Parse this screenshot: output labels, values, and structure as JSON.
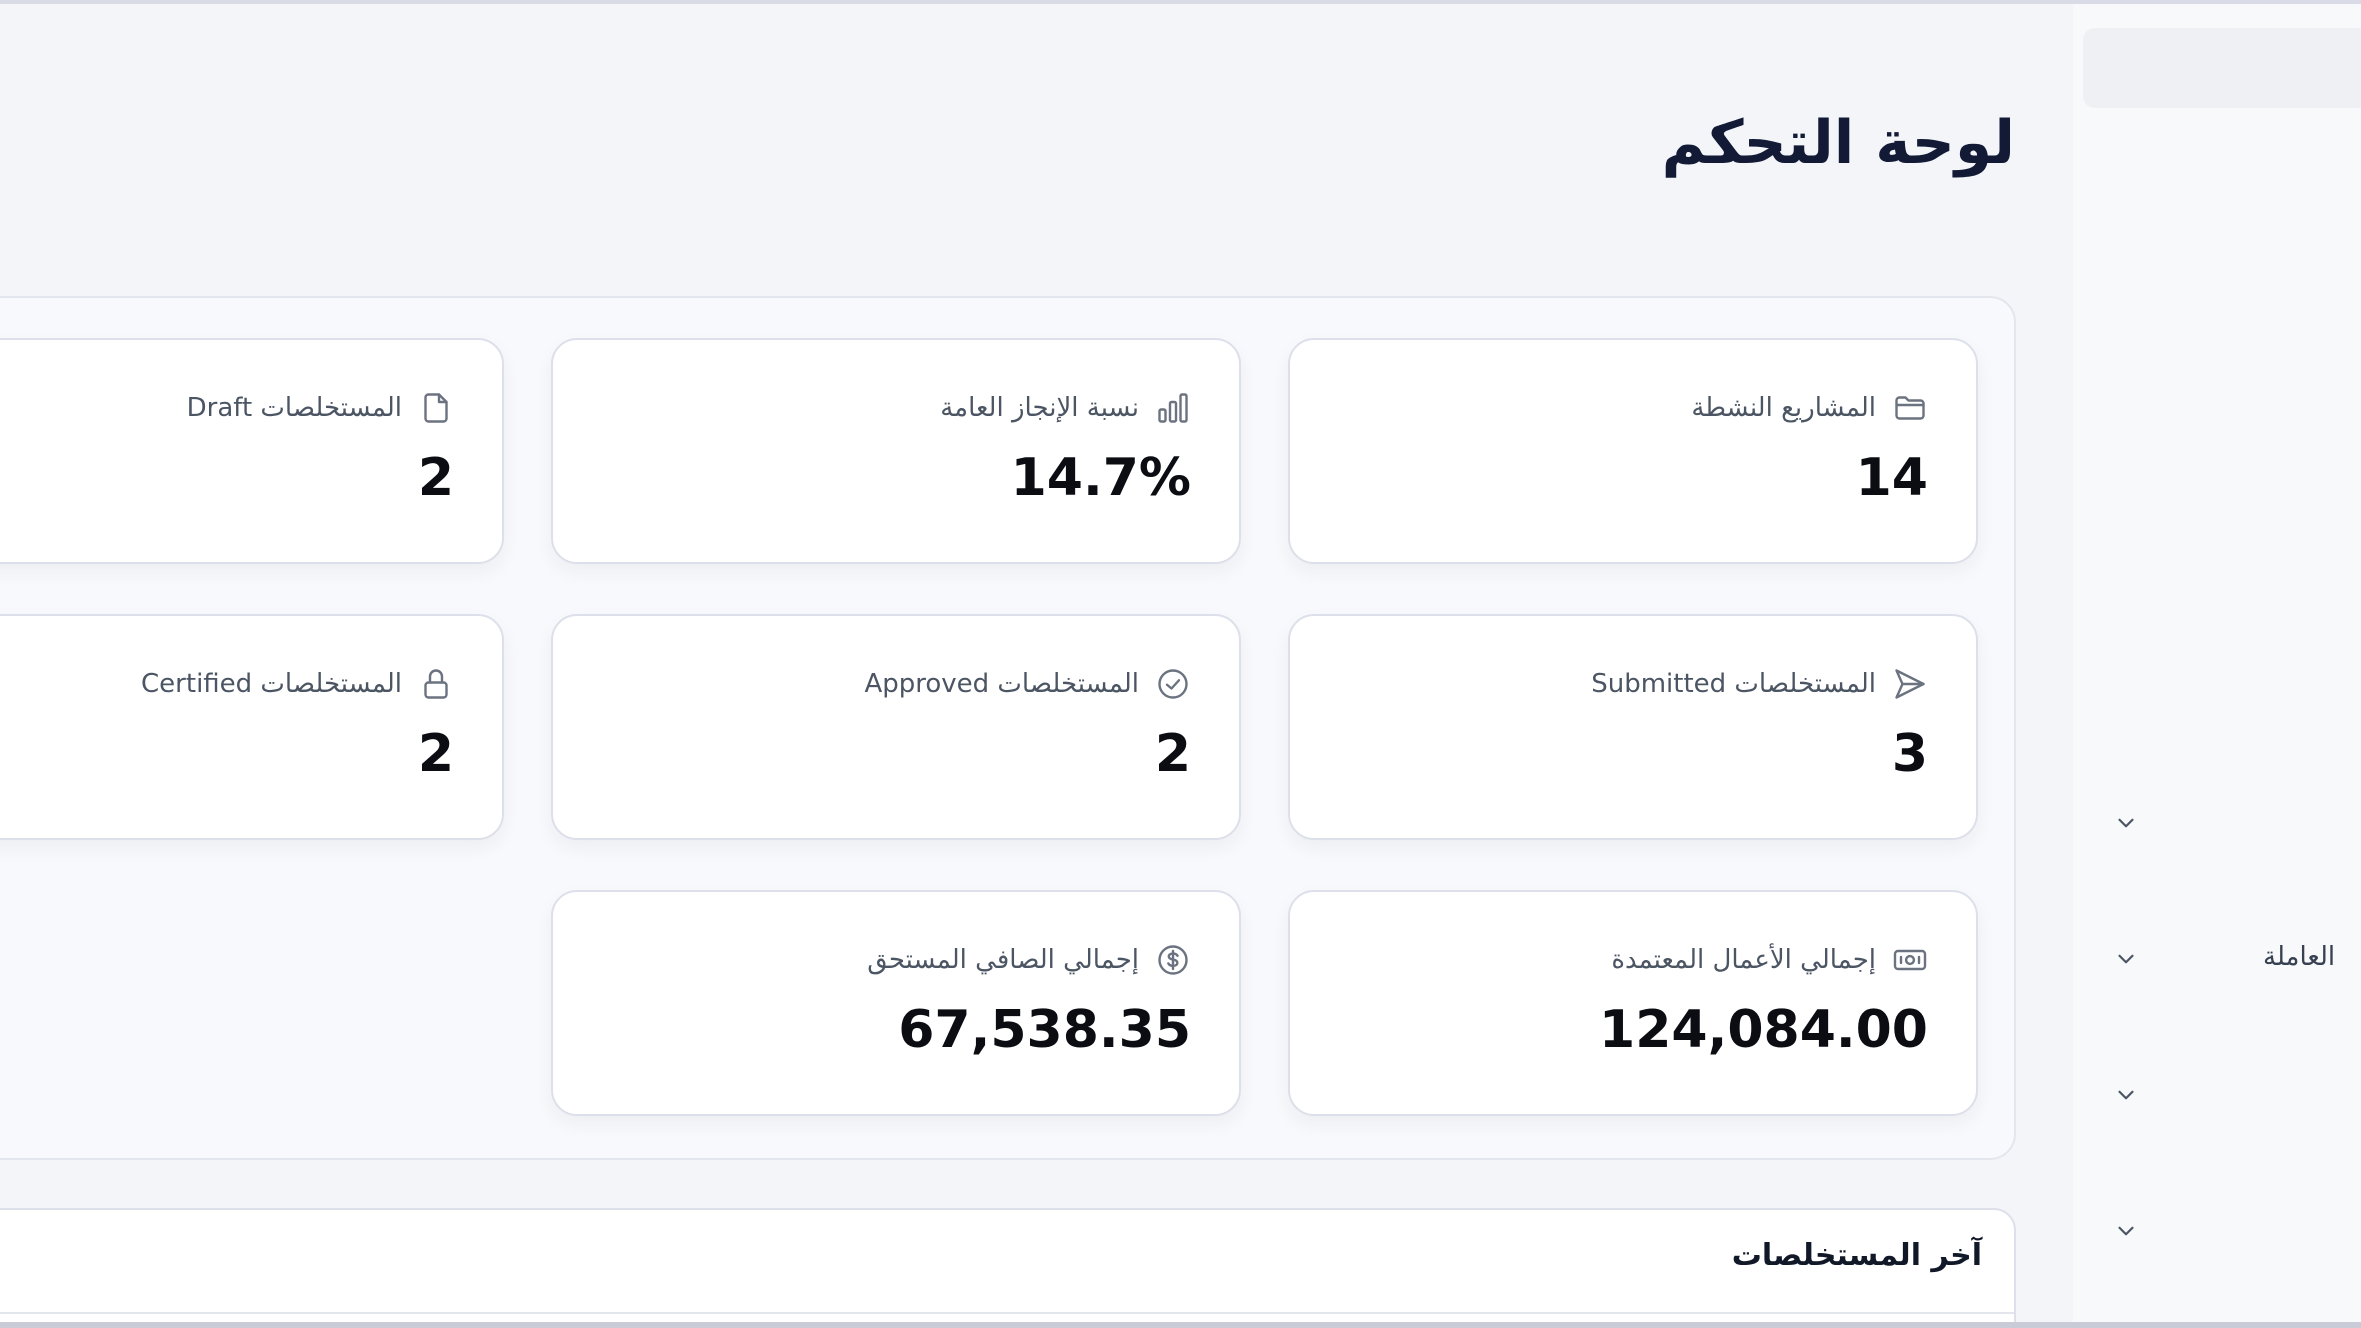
{
  "page": {
    "title": "لوحة التحكم"
  },
  "sidebar": {
    "items": [
      {
        "label": "",
        "icon": "chevron-down-icon"
      },
      {
        "label": "العاملة",
        "icon": "chevron-down-icon"
      },
      {
        "label": "",
        "icon": "chevron-down-icon"
      },
      {
        "label": "",
        "icon": "chevron-down-icon"
      }
    ]
  },
  "stats": [
    {
      "label": "المشاريع النشطة",
      "value": "14",
      "icon": "folder-icon"
    },
    {
      "label": "نسبة الإنجاز العامة",
      "value": "14.7%",
      "icon": "bar-chart-icon"
    },
    {
      "label": "المستخلصات Draft",
      "value": "2",
      "icon": "document-icon"
    },
    {
      "label": "المستخلصات Submitted",
      "value": "3",
      "icon": "send-icon"
    },
    {
      "label": "المستخلصات Approved",
      "value": "2",
      "icon": "check-circle-icon"
    },
    {
      "label": "المستخلصات Certified",
      "value": "2",
      "icon": "lock-icon"
    },
    {
      "label": "إجمالي الأعمال المعتمدة",
      "value": "124,084.00",
      "icon": "banknote-icon"
    },
    {
      "label": "إجمالي الصافي المستحق",
      "value": "67,538.35",
      "icon": "dollar-circle-icon"
    }
  ],
  "latest": {
    "title": "آخر المستخلصات"
  },
  "colors": {
    "background": "#f4f5f9",
    "card": "#ffffff",
    "title": "#121a36",
    "muted": "#4b5563"
  }
}
